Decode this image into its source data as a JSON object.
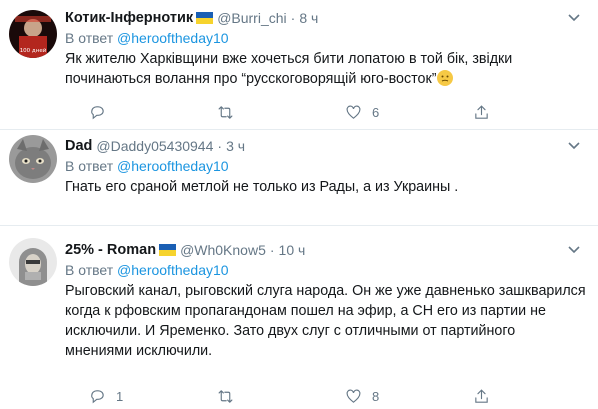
{
  "tweets": [
    {
      "name": "Котик-Інфернотик",
      "handle": "@Burri_chi",
      "time": "8 ч",
      "reply_prefix": "В ответ",
      "reply_to": "@herooftheday10",
      "text": "Як жителю Харківщини вже хочеться бити лопатою в той бік, звідки починаються волання про “русскоговорящій юго-восток”",
      "avatar_text": "100 дней",
      "replies": "",
      "retweets": "",
      "likes": "6"
    },
    {
      "name": "Dad",
      "handle": "@Daddy05430944",
      "time": "3 ч",
      "reply_prefix": "В ответ",
      "reply_to": "@herooftheday10",
      "text": "Гнать его сраной метлой не только из Рады, а из Украины ."
    },
    {
      "name": "25% - Roman",
      "handle": "@Wh0Know5",
      "time": "10 ч",
      "reply_prefix": "В ответ",
      "reply_to": "@herooftheday10",
      "text": "Рыговский канал, рыговский слуга народа. Он же уже давненько зашкварился когда к рфовским пропагандонам пошел на эфир, а СН его из партии не исключили. И Яременко. Зато двух слуг с отличными от партийного мнениями исключили.",
      "replies": "1",
      "retweets": "",
      "likes": "8"
    }
  ],
  "colors": {
    "link": "#1b95e0",
    "secondary": "#657786",
    "divider": "#e6ecf0",
    "flag_blue": "#1a5fb4",
    "flag_yellow": "#f6d32d"
  },
  "icons": [
    "chevron-down-icon",
    "reply-icon",
    "retweet-icon",
    "like-icon",
    "share-icon",
    "ukraine-flag-icon",
    "emoji-icon"
  ]
}
